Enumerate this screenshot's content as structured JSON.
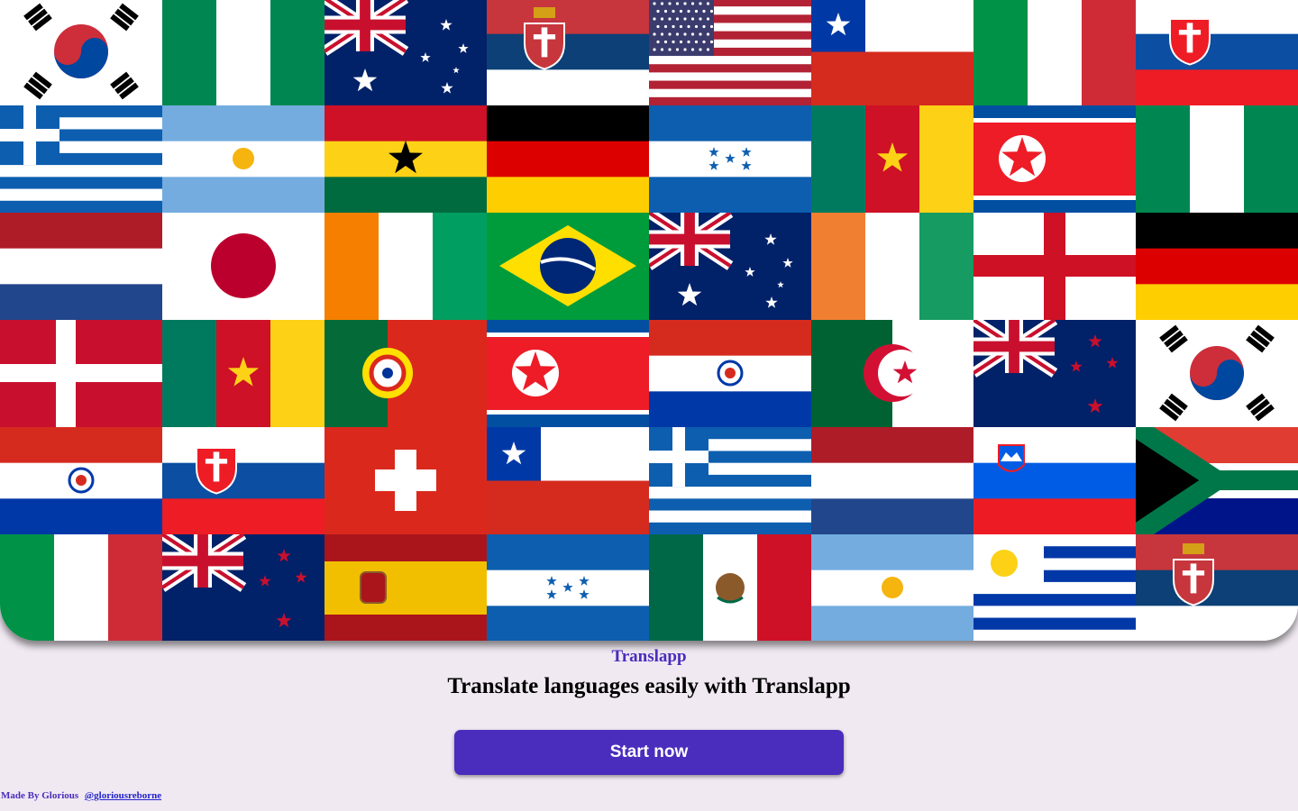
{
  "brand": {
    "name": "Translapp",
    "accent": "#4a2dbc"
  },
  "hero": {
    "tagline": "Translate languages easily with Translapp"
  },
  "cta": {
    "label": "Start now"
  },
  "footer": {
    "credit_prefix": "Made By Glorious",
    "handle": "@gloriousreborne"
  },
  "flag_grid": {
    "rows": [
      [
        "south-korea",
        "nigeria",
        "australia",
        "serbia",
        "usa",
        "chile",
        "italy",
        "slovakia"
      ],
      [
        "greece",
        "argentina",
        "ghana",
        "germany",
        "honduras",
        "cameroon",
        "north-korea",
        "nigeria"
      ],
      [
        "netherlands",
        "japan",
        "ivory-coast",
        "brazil",
        "australia",
        "ireland",
        "england",
        "germany"
      ],
      [
        "denmark",
        "cameroon",
        "portugal",
        "north-korea",
        "paraguay",
        "algeria",
        "new-zealand",
        "south-korea"
      ],
      [
        "paraguay",
        "slovakia",
        "switzerland",
        "chile",
        "greece",
        "netherlands",
        "slovenia",
        "south-africa"
      ],
      [
        "italy",
        "new-zealand",
        "spain",
        "honduras",
        "mexico",
        "argentina",
        "uruguay",
        "serbia"
      ]
    ]
  }
}
